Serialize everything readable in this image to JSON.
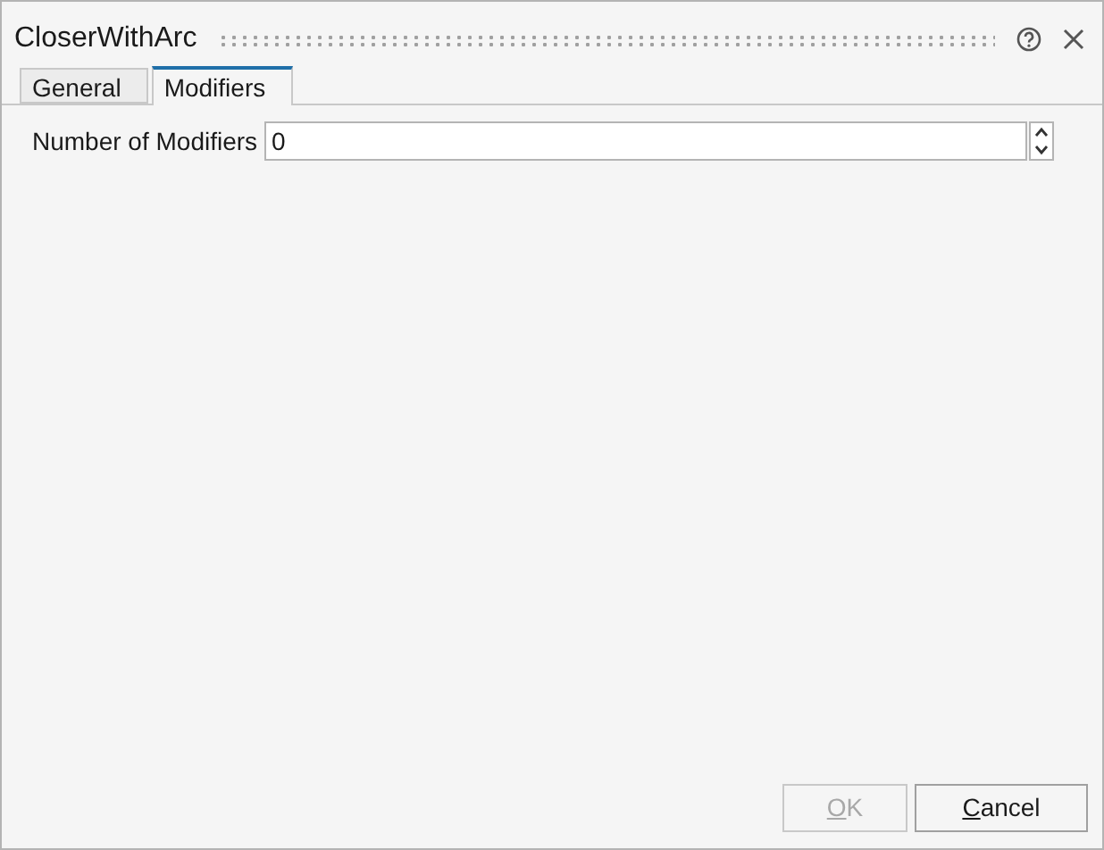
{
  "window": {
    "title": "CloserWithArc"
  },
  "tabs": [
    {
      "label": "General",
      "selected": false
    },
    {
      "label": "Modifiers",
      "selected": true
    }
  ],
  "field": {
    "label": "Number of Modifiers",
    "value": "0"
  },
  "buttons": [
    {
      "label": "OK",
      "disabled": true
    },
    {
      "label": "Cancel",
      "disabled": false
    }
  ]
}
